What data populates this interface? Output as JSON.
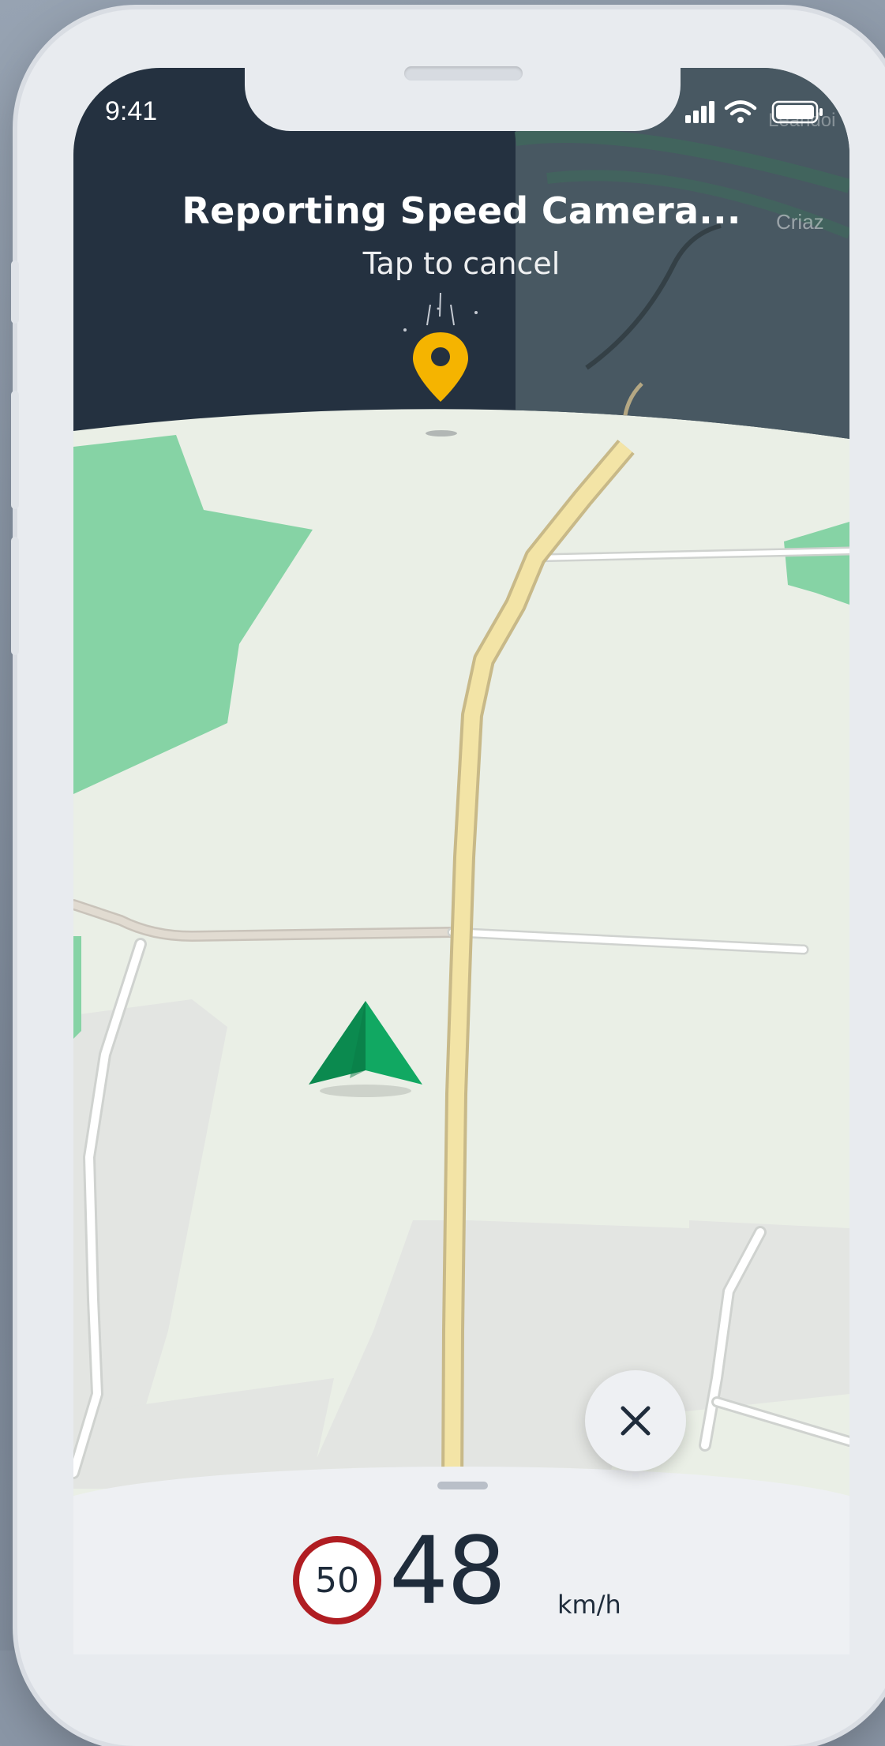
{
  "status_bar": {
    "time": "9:41",
    "icons": [
      "cellular-signal-icon",
      "wifi-icon",
      "battery-icon"
    ]
  },
  "header": {
    "title": "Reporting Speed Camera...",
    "subtitle": "Tap to cancel",
    "marker_icon": "location-pin-icon"
  },
  "map": {
    "labels": [
      "Leandoi",
      "Criaz"
    ],
    "colors": {
      "land": "#eaefe6",
      "forest": "#86d3a5",
      "urban": "#e4e6e3",
      "route": "#f3e4a6",
      "header_bg": "#243140"
    },
    "current_position_icon": "navigation-arrow-icon"
  },
  "bottom_panel": {
    "speed_limit": "50",
    "current_speed": "48",
    "unit": "km/h"
  },
  "close_button": {
    "icon": "close-icon"
  },
  "accent_color": "#f5b400"
}
